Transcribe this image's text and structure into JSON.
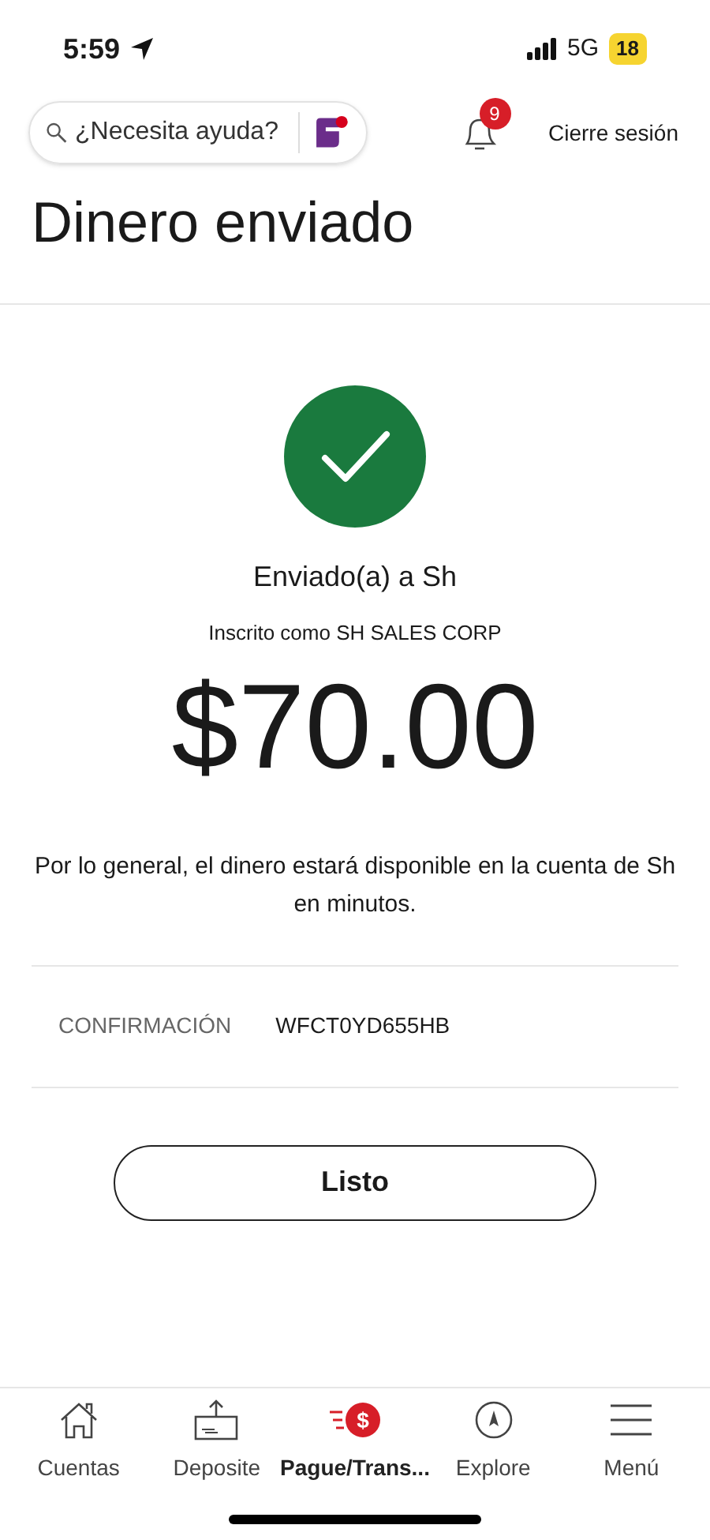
{
  "status_bar": {
    "time": "5:59",
    "network": "5G",
    "battery": "18"
  },
  "header": {
    "search": {
      "placeholder": "¿Necesita ayuda?"
    },
    "notifications": "9",
    "logout": "Cierre sesión"
  },
  "title": "Dinero enviado",
  "confirmation": {
    "recipient": "Enviado(a) a Sh",
    "enrolled": "Inscrito como SH SALES CORP",
    "amount": "$70.00",
    "note": "Por lo general, el dinero estará disponible en la cuenta de Sh en minutos.",
    "label": "CONFIRMACIÓN",
    "code": "WFCT0YD655HB"
  },
  "button": "Listo",
  "tabs": [
    {
      "kind": "home",
      "label": "Cuentas",
      "selected": false
    },
    {
      "kind": "deposit",
      "label": "Deposite",
      "selected": false
    },
    {
      "kind": "pay",
      "label": "Pague/Trans...",
      "selected": true,
      "symbol": "$"
    },
    {
      "kind": "explore",
      "label": "Explore",
      "selected": false
    },
    {
      "kind": "menu",
      "label": "Menú",
      "selected": false
    }
  ]
}
